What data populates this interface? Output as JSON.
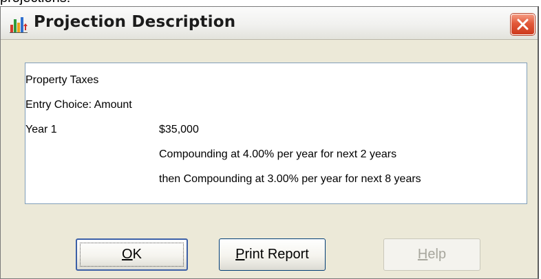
{
  "background_caption": "projections:",
  "window": {
    "title": "Projection Description",
    "app_icon": "bar-chart-icon",
    "close_icon": "close-x-icon"
  },
  "description": {
    "heading": "Property Taxes",
    "entry_choice": "Entry Choice: Amount",
    "year_label": "Year 1",
    "amount": "$35,000",
    "lines": [
      "Compounding at 4.00% per year for next 2 years",
      "then Compounding at 3.00% per year for next 8 years"
    ]
  },
  "buttons": {
    "ok": {
      "mnemonic": "O",
      "rest": "K"
    },
    "print": {
      "mnemonic": "P",
      "rest": "rint Report"
    },
    "help": {
      "mnemonic": "H",
      "rest": "elp",
      "disabled": true
    }
  },
  "colors": {
    "dialog_bg": "#ece9d8",
    "close_button": "#e2593a",
    "button_border": "#003c74",
    "disabled_text": "#a7a69d"
  }
}
